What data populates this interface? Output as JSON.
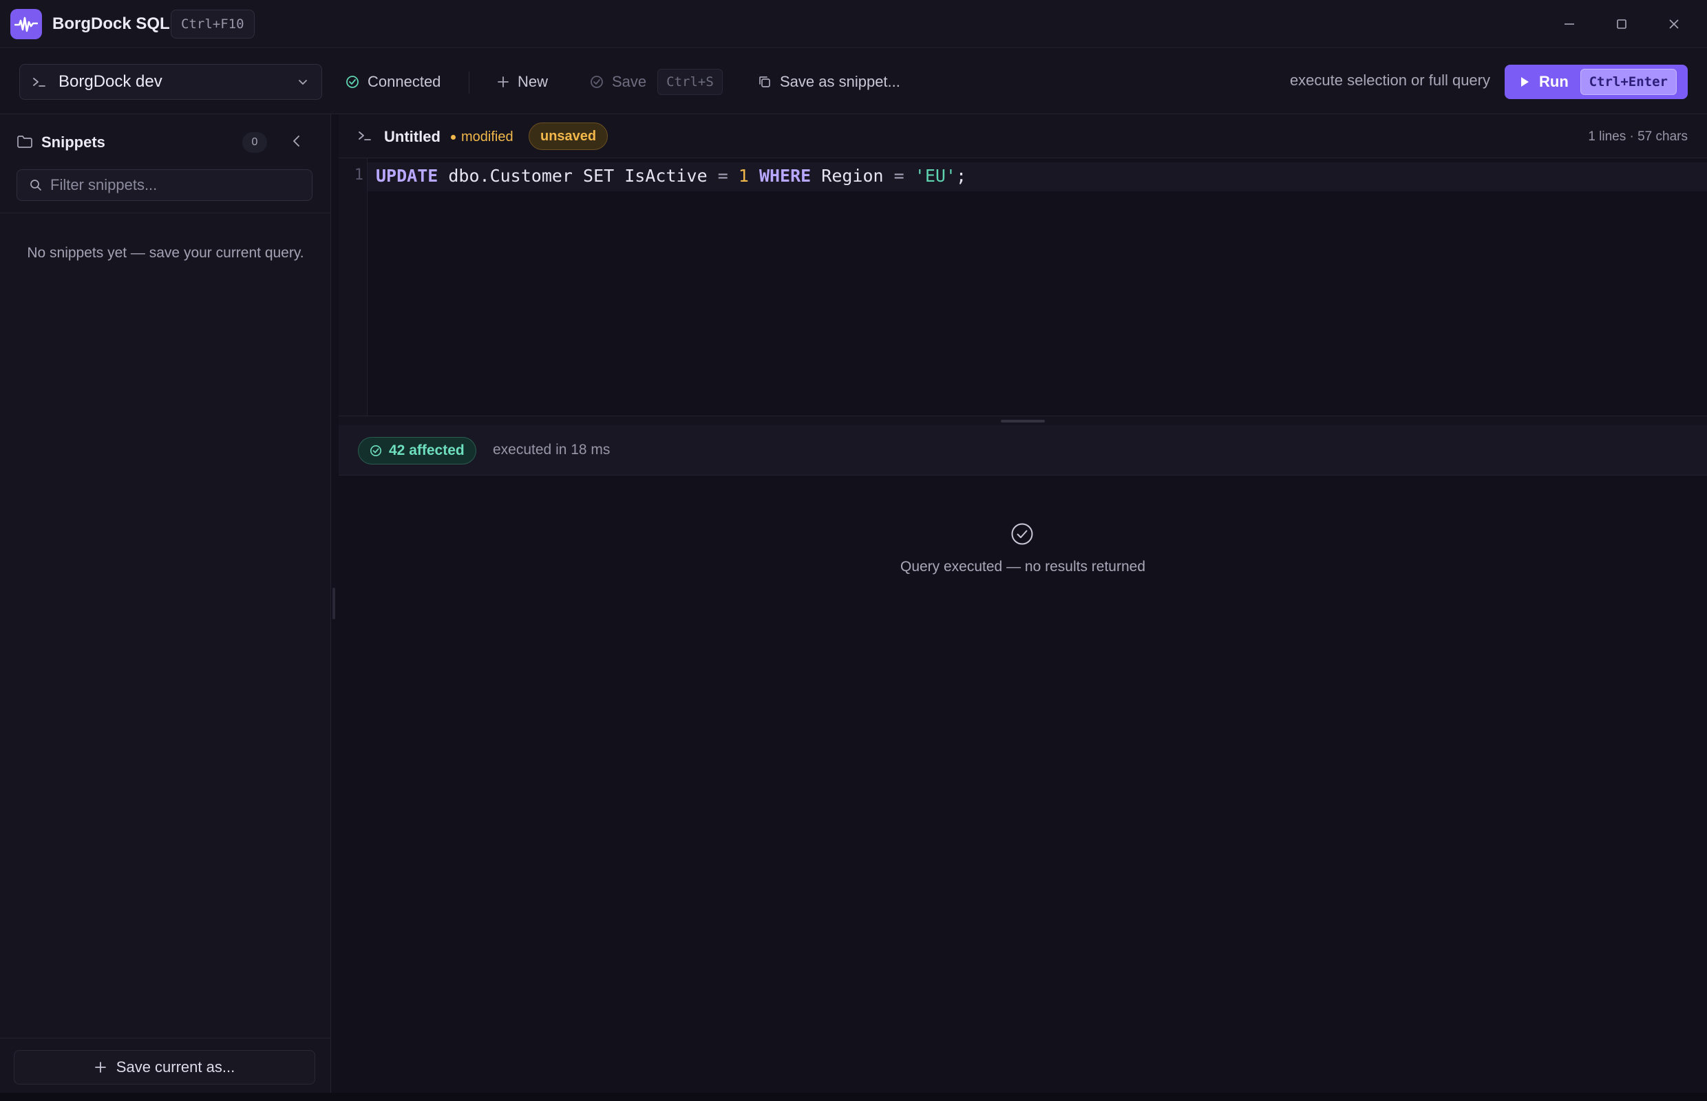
{
  "window": {
    "title": "BorgDock SQL",
    "shortcut": "Ctrl+F10",
    "accent": "#7b5cf5",
    "controls": [
      "minimize-icon",
      "maximize-icon",
      "close-icon"
    ]
  },
  "toolbar": {
    "connection": "BorgDock dev",
    "status": "Connected",
    "new_label": "New",
    "save_label": "Save",
    "save_shortcut": "Ctrl+S",
    "snippet_label": "Save as snippet...",
    "hint": "execute selection or full query",
    "run_label": "Run",
    "run_shortcut": "Ctrl+Enter"
  },
  "sidebar": {
    "title": "Snippets",
    "count": "0",
    "filter_placeholder": "Filter snippets...",
    "empty_text": "No snippets yet — save your current query.",
    "save_current_label": "Save current as..."
  },
  "editor": {
    "tab_title": "Untitled",
    "modified_label": "modified",
    "unsaved_label": "unsaved",
    "stats": "1 lines · 57 chars",
    "line_number": "1",
    "code_tokens": [
      {
        "text": "UPDATE",
        "kind": "kw"
      },
      {
        "text": " dbo.Customer SET IsActive ",
        "kind": "plain"
      },
      {
        "text": "=",
        "kind": "op"
      },
      {
        "text": " ",
        "kind": "plain"
      },
      {
        "text": "1",
        "kind": "num"
      },
      {
        "text": " ",
        "kind": "plain"
      },
      {
        "text": "WHERE",
        "kind": "kw"
      },
      {
        "text": " Region ",
        "kind": "plain"
      },
      {
        "text": "=",
        "kind": "op"
      },
      {
        "text": " ",
        "kind": "plain"
      },
      {
        "text": "'EU'",
        "kind": "str"
      },
      {
        "text": ";",
        "kind": "plain"
      }
    ]
  },
  "results": {
    "affected_label": "42 affected",
    "exec_time": "executed in 18 ms",
    "message": "Query executed — no results returned"
  }
}
